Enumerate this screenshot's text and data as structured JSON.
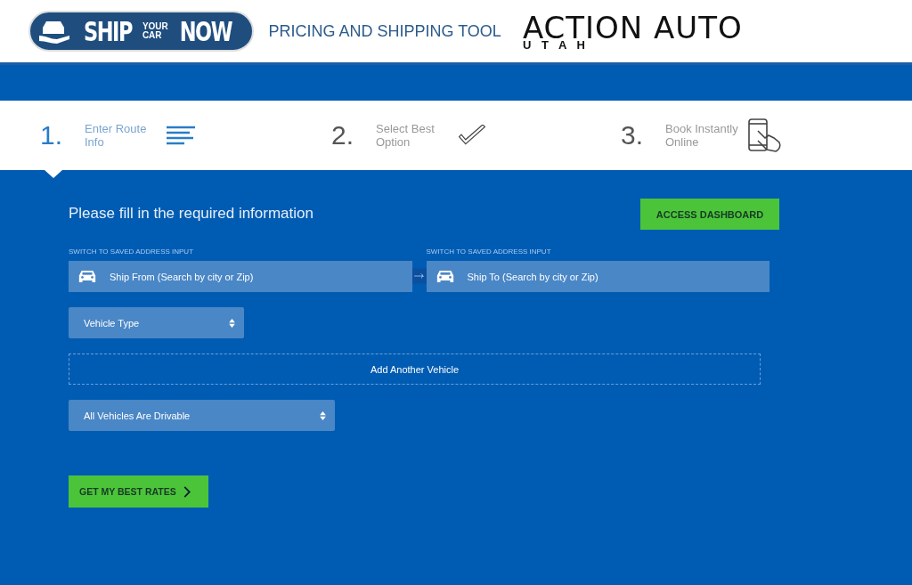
{
  "header": {
    "logo": {
      "ship": "SHIP",
      "your": "YOUR",
      "car": "CAR",
      "now": "NOW"
    },
    "title": "PRICING AND SHIPPING TOOL",
    "partner_logo": {
      "main": "ACTION AUTO",
      "sub": "U T A H"
    }
  },
  "steps": [
    {
      "number": "1.",
      "label": "Enter Route Info",
      "selected": true,
      "kind": "lines"
    },
    {
      "number": "2.",
      "label": "Select Best Option",
      "selected": false,
      "kind": "check"
    },
    {
      "number": "3.",
      "label": "Book Instantly Online",
      "selected": false,
      "kind": "phone"
    }
  ],
  "form": {
    "heading": "Please fill in the required information",
    "dashboard_button": "ACCESS DASHBOARD",
    "from": {
      "switch_link": "SWITCH TO SAVED ADDRESS INPUT",
      "placeholder": "Ship From (Search by city or Zip)"
    },
    "to": {
      "switch_link": "SWITCH TO SAVED ADDRESS INPUT",
      "placeholder": "Ship To (Search by city or Zip)"
    },
    "vehicle_type": "Vehicle Type",
    "add_vehicle": "Add Another Vehicle",
    "drivable": "All Vehicles Are Drivable",
    "submit": "GET MY BEST RATES"
  }
}
